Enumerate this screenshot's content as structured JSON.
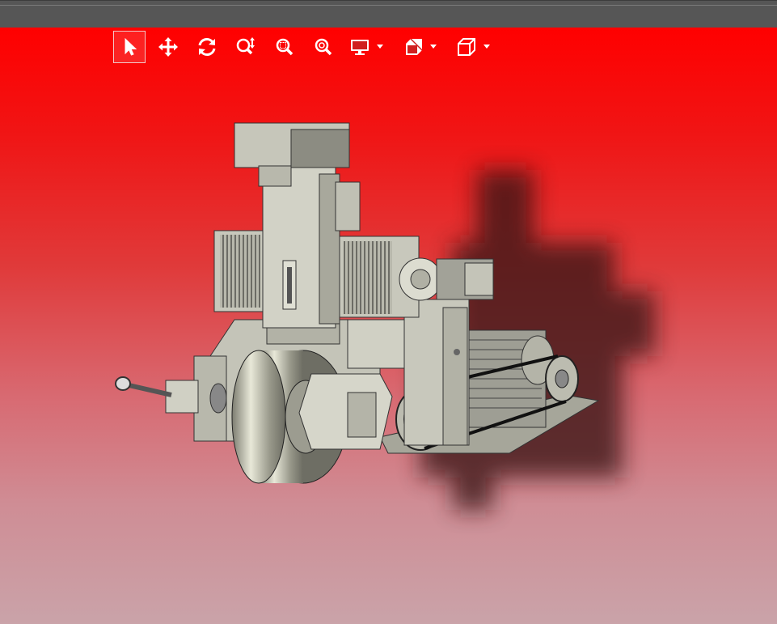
{
  "window": {
    "title": ""
  },
  "toolbar": {
    "tools": [
      {
        "name": "select",
        "icon": "cursor-arrow-icon",
        "active": true
      },
      {
        "name": "pan",
        "icon": "move-arrows-icon",
        "active": false
      },
      {
        "name": "rotate",
        "icon": "rotate-icon",
        "active": false
      },
      {
        "name": "zoom",
        "icon": "zoom-updown-icon",
        "active": false
      },
      {
        "name": "zoom-window",
        "icon": "zoom-window-icon",
        "active": false
      },
      {
        "name": "zoom-fit",
        "icon": "zoom-fit-icon",
        "active": false
      },
      {
        "name": "display-mode",
        "icon": "monitor-icon",
        "dropdown": true
      },
      {
        "name": "section-view",
        "icon": "section-cube-icon",
        "dropdown": true
      },
      {
        "name": "view-orientation",
        "icon": "cube-icon",
        "dropdown": true
      }
    ]
  },
  "colors": {
    "toolbar_bg": "#565656",
    "viewport_top": "#ff0000",
    "viewport_bottom": "#caa3a9",
    "model_body": "#c8c8bc",
    "model_shadow": "#3a1414"
  },
  "scene": {
    "subject": "3d-machine-assembly"
  }
}
